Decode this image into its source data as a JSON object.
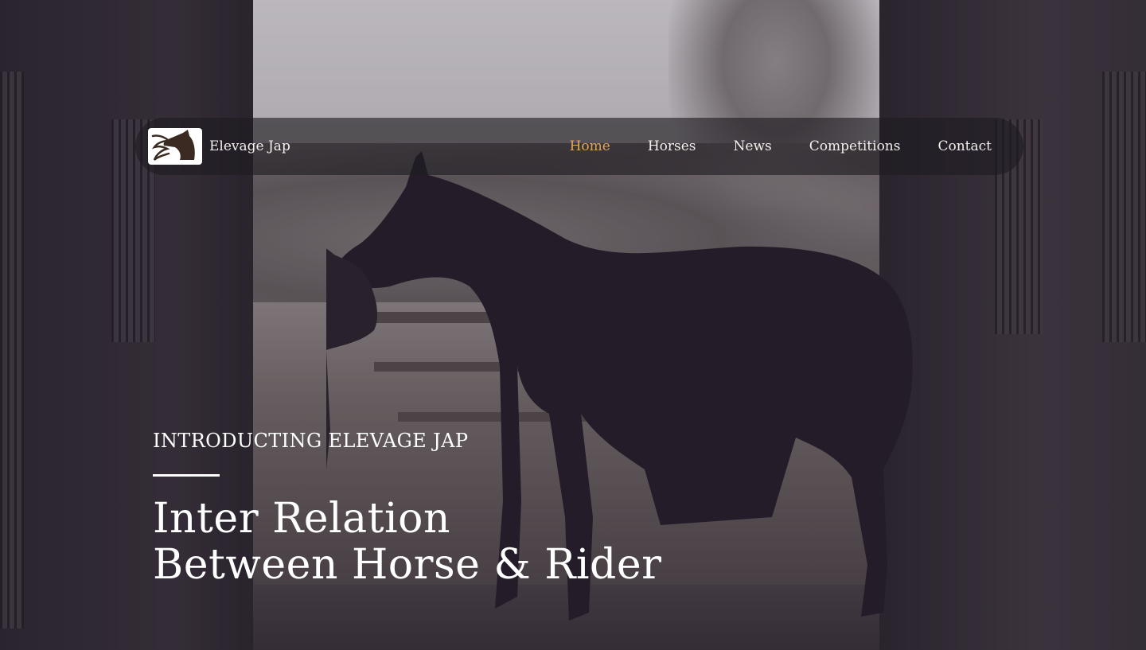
{
  "brand": {
    "name": "Elevage Jap",
    "logo_icon": "horse-head-logo"
  },
  "nav": {
    "items": [
      {
        "label": "Home",
        "active": true
      },
      {
        "label": "Horses",
        "active": false
      },
      {
        "label": "News",
        "active": false
      },
      {
        "label": "Competitions",
        "active": false
      },
      {
        "label": "Contact",
        "active": false
      }
    ]
  },
  "hero": {
    "eyebrow": "INTRODUCTING ELEVAGE JAP",
    "headline_line1": "Inter Relation",
    "headline_line2": "Between Horse & Rider",
    "background": "Silhouette of a rider kissing a horse in a barn doorway"
  },
  "colors": {
    "nav_active": "#e2a55f",
    "nav_text": "#f2efec",
    "nav_bg": "rgba(30,28,32,0.62)",
    "hero_text": "#ffffff"
  }
}
